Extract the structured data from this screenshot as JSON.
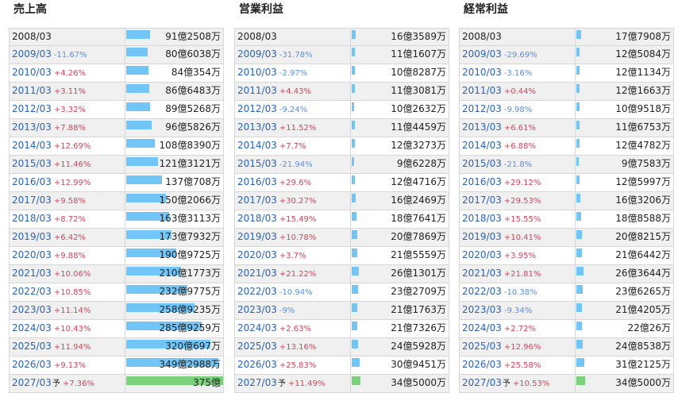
{
  "sections": [
    {
      "title": "売上高",
      "scale_max": 375,
      "rows": [
        {
          "year": "2008/03",
          "change": "",
          "dir": "",
          "est": false,
          "value": "91億2508万",
          "num": 91.25
        },
        {
          "year": "2009/03",
          "change": "-11.67%",
          "dir": "neg",
          "est": false,
          "value": "80億6038万",
          "num": 80.6
        },
        {
          "year": "2010/03",
          "change": "+4.26%",
          "dir": "pos",
          "est": false,
          "value": "84億354万",
          "num": 84.04
        },
        {
          "year": "2011/03",
          "change": "+3.11%",
          "dir": "pos",
          "est": false,
          "value": "86億6483万",
          "num": 86.65
        },
        {
          "year": "2012/03",
          "change": "+3.32%",
          "dir": "pos",
          "est": false,
          "value": "89億5268万",
          "num": 89.53
        },
        {
          "year": "2013/03",
          "change": "+7.88%",
          "dir": "pos",
          "est": false,
          "value": "96億5826万",
          "num": 96.58
        },
        {
          "year": "2014/03",
          "change": "+12.69%",
          "dir": "pos",
          "est": false,
          "value": "108億8390万",
          "num": 108.84
        },
        {
          "year": "2015/03",
          "change": "+11.46%",
          "dir": "pos",
          "est": false,
          "value": "121億3121万",
          "num": 121.31
        },
        {
          "year": "2016/03",
          "change": "+12.99%",
          "dir": "pos",
          "est": false,
          "value": "137億708万",
          "num": 137.07
        },
        {
          "year": "2017/03",
          "change": "+9.58%",
          "dir": "pos",
          "est": false,
          "value": "150億2066万",
          "num": 150.21
        },
        {
          "year": "2018/03",
          "change": "+8.72%",
          "dir": "pos",
          "est": false,
          "value": "163億3113万",
          "num": 163.31
        },
        {
          "year": "2019/03",
          "change": "+6.42%",
          "dir": "pos",
          "est": false,
          "value": "173億7932万",
          "num": 173.79
        },
        {
          "year": "2020/03",
          "change": "+9.88%",
          "dir": "pos",
          "est": false,
          "value": "190億9725万",
          "num": 190.97
        },
        {
          "year": "2021/03",
          "change": "+10.06%",
          "dir": "pos",
          "est": false,
          "value": "210億1773万",
          "num": 210.18
        },
        {
          "year": "2022/03",
          "change": "+10.85%",
          "dir": "pos",
          "est": false,
          "value": "232億9775万",
          "num": 232.98
        },
        {
          "year": "2023/03",
          "change": "+11.14%",
          "dir": "pos",
          "est": false,
          "value": "258億9235万",
          "num": 258.92
        },
        {
          "year": "2024/03",
          "change": "+10.43%",
          "dir": "pos",
          "est": false,
          "value": "285億9259万",
          "num": 285.93
        },
        {
          "year": "2025/03",
          "change": "+11.94%",
          "dir": "pos",
          "est": false,
          "value": "320億697万",
          "num": 320.07
        },
        {
          "year": "2026/03",
          "change": "+9.13%",
          "dir": "pos",
          "est": false,
          "value": "349億2988万",
          "num": 349.3
        },
        {
          "year": "2027/03",
          "change": "+7.36%",
          "dir": "pos",
          "est": true,
          "value": "375億",
          "num": 375
        }
      ]
    },
    {
      "title": "営業利益",
      "scale_max": 375,
      "rows": [
        {
          "year": "2008/03",
          "change": "",
          "dir": "",
          "est": false,
          "value": "16億3589万",
          "num": 16.36
        },
        {
          "year": "2009/03",
          "change": "-31.78%",
          "dir": "neg",
          "est": false,
          "value": "11億1607万",
          "num": 11.16
        },
        {
          "year": "2010/03",
          "change": "-2.97%",
          "dir": "neg",
          "est": false,
          "value": "10億8287万",
          "num": 10.83
        },
        {
          "year": "2011/03",
          "change": "+4.43%",
          "dir": "pos",
          "est": false,
          "value": "11億3081万",
          "num": 11.31
        },
        {
          "year": "2012/03",
          "change": "-9.24%",
          "dir": "neg",
          "est": false,
          "value": "10億2632万",
          "num": 10.26
        },
        {
          "year": "2013/03",
          "change": "+11.52%",
          "dir": "pos",
          "est": false,
          "value": "11億4459万",
          "num": 11.45
        },
        {
          "year": "2014/03",
          "change": "+7.7%",
          "dir": "pos",
          "est": false,
          "value": "12億3273万",
          "num": 12.33
        },
        {
          "year": "2015/03",
          "change": "-21.94%",
          "dir": "neg",
          "est": false,
          "value": "9億6228万",
          "num": 9.62
        },
        {
          "year": "2016/03",
          "change": "+29.6%",
          "dir": "pos",
          "est": false,
          "value": "12億4716万",
          "num": 12.47
        },
        {
          "year": "2017/03",
          "change": "+30.27%",
          "dir": "pos",
          "est": false,
          "value": "16億2469万",
          "num": 16.25
        },
        {
          "year": "2018/03",
          "change": "+15.49%",
          "dir": "pos",
          "est": false,
          "value": "18億7641万",
          "num": 18.76
        },
        {
          "year": "2019/03",
          "change": "+10.78%",
          "dir": "pos",
          "est": false,
          "value": "20億7869万",
          "num": 20.79
        },
        {
          "year": "2020/03",
          "change": "+3.7%",
          "dir": "pos",
          "est": false,
          "value": "21億5559万",
          "num": 21.56
        },
        {
          "year": "2021/03",
          "change": "+21.22%",
          "dir": "pos",
          "est": false,
          "value": "26億1301万",
          "num": 26.13
        },
        {
          "year": "2022/03",
          "change": "-10.94%",
          "dir": "neg",
          "est": false,
          "value": "23億2709万",
          "num": 23.27
        },
        {
          "year": "2023/03",
          "change": "-9%",
          "dir": "neg",
          "est": false,
          "value": "21億1763万",
          "num": 21.18
        },
        {
          "year": "2024/03",
          "change": "+2.63%",
          "dir": "pos",
          "est": false,
          "value": "21億7326万",
          "num": 21.73
        },
        {
          "year": "2025/03",
          "change": "+13.16%",
          "dir": "pos",
          "est": false,
          "value": "24億5928万",
          "num": 24.59
        },
        {
          "year": "2026/03",
          "change": "+25.83%",
          "dir": "pos",
          "est": false,
          "value": "30億9451万",
          "num": 30.95
        },
        {
          "year": "2027/03",
          "change": "+11.49%",
          "dir": "pos",
          "est": true,
          "value": "34億5000万",
          "num": 34.5
        }
      ]
    },
    {
      "title": "経常利益",
      "scale_max": 375,
      "rows": [
        {
          "year": "2008/03",
          "change": "",
          "dir": "",
          "est": false,
          "value": "17億7908万",
          "num": 17.79
        },
        {
          "year": "2009/03",
          "change": "-29.69%",
          "dir": "neg",
          "est": false,
          "value": "12億5084万",
          "num": 12.51
        },
        {
          "year": "2010/03",
          "change": "-3.16%",
          "dir": "neg",
          "est": false,
          "value": "12億1134万",
          "num": 12.11
        },
        {
          "year": "2011/03",
          "change": "+0.44%",
          "dir": "pos",
          "est": false,
          "value": "12億1663万",
          "num": 12.17
        },
        {
          "year": "2012/03",
          "change": "-9.98%",
          "dir": "neg",
          "est": false,
          "value": "10億9518万",
          "num": 10.95
        },
        {
          "year": "2013/03",
          "change": "+6.61%",
          "dir": "pos",
          "est": false,
          "value": "11億6753万",
          "num": 11.68
        },
        {
          "year": "2014/03",
          "change": "+6.88%",
          "dir": "pos",
          "est": false,
          "value": "12億4782万",
          "num": 12.48
        },
        {
          "year": "2015/03",
          "change": "-21.8%",
          "dir": "neg",
          "est": false,
          "value": "9億7583万",
          "num": 9.76
        },
        {
          "year": "2016/03",
          "change": "+29.12%",
          "dir": "pos",
          "est": false,
          "value": "12億5997万",
          "num": 12.6
        },
        {
          "year": "2017/03",
          "change": "+29.53%",
          "dir": "pos",
          "est": false,
          "value": "16億3206万",
          "num": 16.32
        },
        {
          "year": "2018/03",
          "change": "+15.55%",
          "dir": "pos",
          "est": false,
          "value": "18億8588万",
          "num": 18.86
        },
        {
          "year": "2019/03",
          "change": "+10.41%",
          "dir": "pos",
          "est": false,
          "value": "20億8215万",
          "num": 20.82
        },
        {
          "year": "2020/03",
          "change": "+3.95%",
          "dir": "pos",
          "est": false,
          "value": "21億6442万",
          "num": 21.64
        },
        {
          "year": "2021/03",
          "change": "+21.81%",
          "dir": "pos",
          "est": false,
          "value": "26億3644万",
          "num": 26.36
        },
        {
          "year": "2022/03",
          "change": "-10.38%",
          "dir": "neg",
          "est": false,
          "value": "23億6265万",
          "num": 23.63
        },
        {
          "year": "2023/03",
          "change": "-9.34%",
          "dir": "neg",
          "est": false,
          "value": "21億4205万",
          "num": 21.42
        },
        {
          "year": "2024/03",
          "change": "+2.72%",
          "dir": "pos",
          "est": false,
          "value": "22億26万",
          "num": 22.0
        },
        {
          "year": "2025/03",
          "change": "+12.96%",
          "dir": "pos",
          "est": false,
          "value": "24億8538万",
          "num": 24.85
        },
        {
          "year": "2026/03",
          "change": "+25.58%",
          "dir": "pos",
          "est": false,
          "value": "31億2125万",
          "num": 31.21
        },
        {
          "year": "2027/03",
          "change": "+10.53%",
          "dir": "pos",
          "est": true,
          "value": "34億5000万",
          "num": 34.5
        }
      ]
    }
  ],
  "estimate_mark": "予",
  "colors": {
    "bar": "#72c5f7",
    "bar_estimate": "#7cd17c",
    "positive": "#d3455b",
    "negative": "#5b8fe0",
    "link": "#2a63b8"
  },
  "chart_data": [
    {
      "type": "bar",
      "title": "売上高",
      "categories": [
        "2008/03",
        "2009/03",
        "2010/03",
        "2011/03",
        "2012/03",
        "2013/03",
        "2014/03",
        "2015/03",
        "2016/03",
        "2017/03",
        "2018/03",
        "2019/03",
        "2020/03",
        "2021/03",
        "2022/03",
        "2023/03",
        "2024/03",
        "2025/03",
        "2026/03",
        "2027/03"
      ],
      "values": [
        91.25,
        80.6,
        84.04,
        86.65,
        89.53,
        96.58,
        108.84,
        121.31,
        137.07,
        150.21,
        163.31,
        173.79,
        190.97,
        210.18,
        232.98,
        258.92,
        285.93,
        320.07,
        349.3,
        375
      ]
    },
    {
      "type": "bar",
      "title": "営業利益",
      "categories": [
        "2008/03",
        "2009/03",
        "2010/03",
        "2011/03",
        "2012/03",
        "2013/03",
        "2014/03",
        "2015/03",
        "2016/03",
        "2017/03",
        "2018/03",
        "2019/03",
        "2020/03",
        "2021/03",
        "2022/03",
        "2023/03",
        "2024/03",
        "2025/03",
        "2026/03",
        "2027/03"
      ],
      "values": [
        16.36,
        11.16,
        10.83,
        11.31,
        10.26,
        11.45,
        12.33,
        9.62,
        12.47,
        16.25,
        18.76,
        20.79,
        21.56,
        26.13,
        23.27,
        21.18,
        21.73,
        24.59,
        30.95,
        34.5
      ]
    },
    {
      "type": "bar",
      "title": "経常利益",
      "categories": [
        "2008/03",
        "2009/03",
        "2010/03",
        "2011/03",
        "2012/03",
        "2013/03",
        "2014/03",
        "2015/03",
        "2016/03",
        "2017/03",
        "2018/03",
        "2019/03",
        "2020/03",
        "2021/03",
        "2022/03",
        "2023/03",
        "2024/03",
        "2025/03",
        "2026/03",
        "2027/03"
      ],
      "values": [
        17.79,
        12.51,
        12.11,
        12.17,
        10.95,
        11.68,
        12.48,
        9.76,
        12.6,
        16.32,
        18.86,
        20.82,
        21.64,
        26.36,
        23.63,
        21.42,
        22.0,
        24.85,
        31.21,
        34.5
      ]
    }
  ]
}
